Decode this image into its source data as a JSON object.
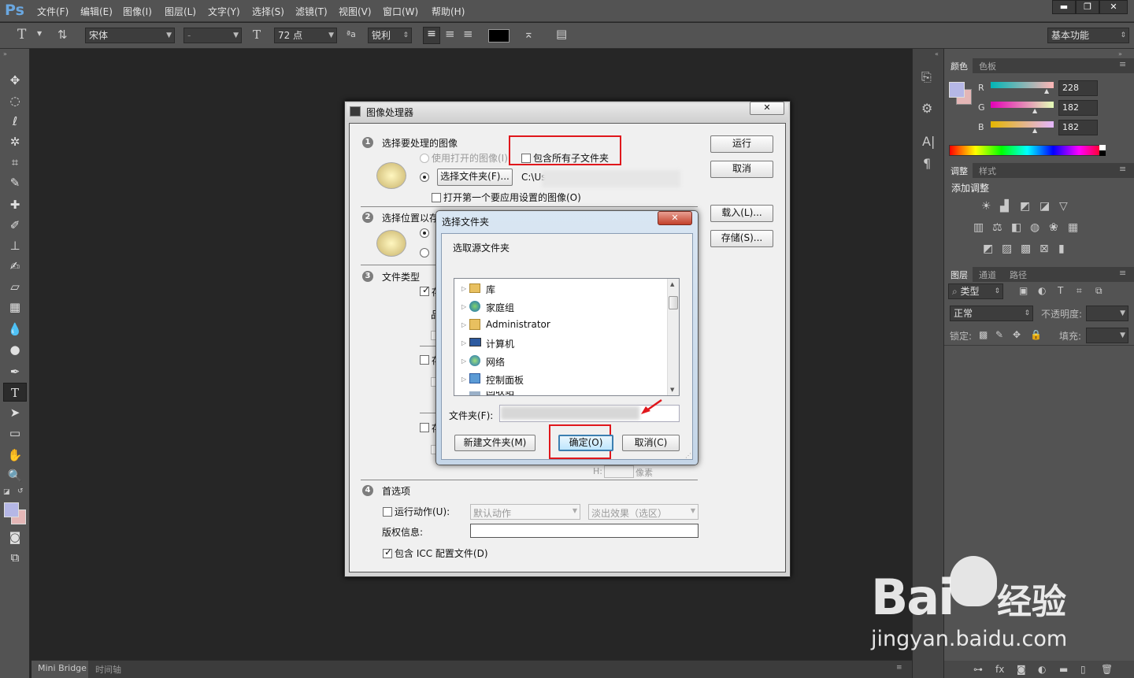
{
  "app": {
    "logo": "Ps",
    "menu": [
      "文件(F)",
      "编辑(E)",
      "图像(I)",
      "图层(L)",
      "文字(Y)",
      "选择(S)",
      "滤镜(T)",
      "视图(V)",
      "窗口(W)",
      "帮助(H)"
    ],
    "window_buttons": [
      "▬",
      "❐",
      "✕"
    ]
  },
  "options": {
    "font_family": "宋体",
    "font_style": "-",
    "font_size": "72 点",
    "antialias": "锐利",
    "workspace": "基本功能",
    "text_color": "#000000"
  },
  "bottom_tabs": [
    "Mini Bridge",
    "时间轴"
  ],
  "panels": {
    "color": {
      "tabs": [
        "颜色",
        "色板"
      ],
      "r_label": "R",
      "g_label": "G",
      "b_label": "B",
      "r": "228",
      "g": "182",
      "b": "182",
      "fg": "#b5b7e6",
      "bg": "#e4b6b6"
    },
    "adjust": {
      "tabs": [
        "调整",
        "样式"
      ],
      "title": "添加调整"
    },
    "layers": {
      "tabs": [
        "图层",
        "通道",
        "路径"
      ],
      "kind": "类型",
      "blend": "正常",
      "opacity_label": "不透明度:",
      "lock_label": "锁定:",
      "fill_label": "填充:"
    }
  },
  "processor": {
    "title": "图像处理器",
    "close": "✕",
    "s1": {
      "num": "1",
      "title": "选择要处理的图像",
      "use_open": "使用打开的图像(I)",
      "include_sub": "包含所有子文件夹",
      "select_folder_btn": "选择文件夹(F)...",
      "path": "C:\\Us",
      "open_first": "打开第一个要应用设置的图像(O)"
    },
    "s2": {
      "num": "2",
      "title": "选择位置以存"
    },
    "s3": {
      "num": "3",
      "title": "文件类型",
      "fragment_a": "存",
      "fragment_b": "品",
      "fragment_c": "存",
      "fragment_d": "存",
      "h_label": "H:",
      "h_unit": "像素"
    },
    "s4": {
      "num": "4",
      "title": "首选项",
      "run_action": "运行动作(U):",
      "action_set": "默认动作",
      "action": "淡出效果（选区）",
      "copyright": "版权信息:",
      "icc": "包含 ICC 配置文件(D)"
    },
    "buttons": {
      "run": "运行",
      "cancel": "取消",
      "load": "载入(L)...",
      "save": "存储(S)..."
    }
  },
  "browse": {
    "title": "选择文件夹",
    "close": "✕",
    "prompt": "选取源文件夹",
    "tree": [
      {
        "label": "库",
        "icon": "library-icon"
      },
      {
        "label": "家庭组",
        "icon": "homegroup-icon"
      },
      {
        "label": "Administrator",
        "icon": "user-folder-icon"
      },
      {
        "label": "计算机",
        "icon": "computer-icon"
      },
      {
        "label": "网络",
        "icon": "network-icon"
      },
      {
        "label": "控制面板",
        "icon": "control-panel-icon"
      },
      {
        "label": "回收站",
        "icon": "recycle-bin-icon"
      }
    ],
    "folder_label": "文件夹(F):",
    "new_folder": "新建文件夹(M)",
    "ok": "确定(O)",
    "cancel": "取消(C)"
  },
  "watermark": {
    "brand": "Bai",
    "brand2": "经验",
    "url": "jingyan.baidu.com"
  }
}
